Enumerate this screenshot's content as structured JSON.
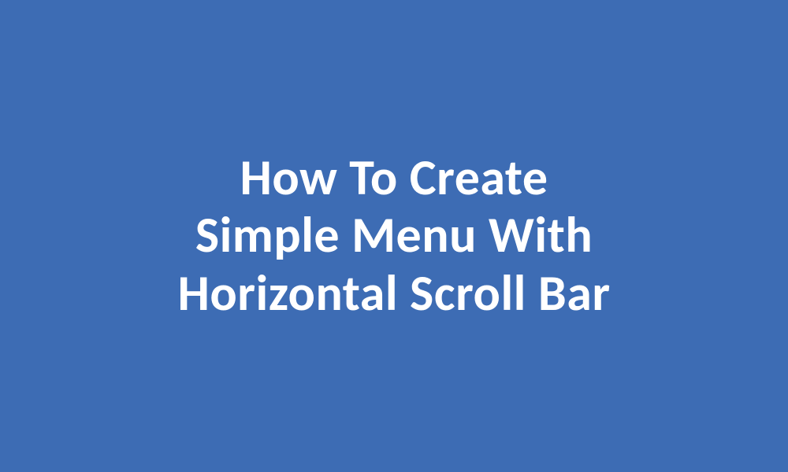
{
  "title": {
    "line1": "How To Create",
    "line2": "Simple Menu With",
    "line3": "Horizontal Scroll Bar"
  },
  "colors": {
    "background": "#3d6cb4",
    "text": "#ffffff"
  }
}
